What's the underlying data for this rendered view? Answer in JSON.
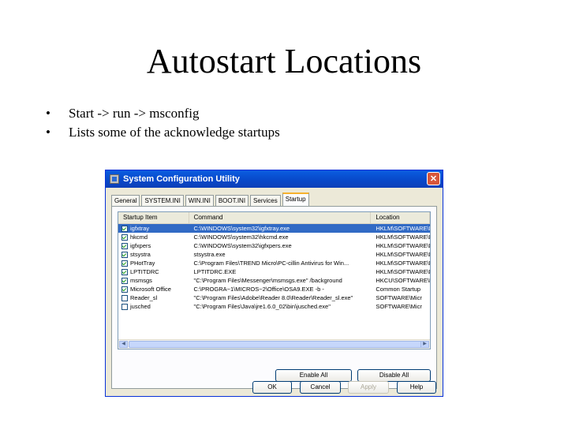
{
  "slide": {
    "title": "Autostart Locations",
    "bullets": [
      "Start -> run -> msconfig",
      "Lists some of the acknowledge startups"
    ]
  },
  "window": {
    "title": "System Configuration Utility",
    "close_label": "✕",
    "tabs": [
      "General",
      "SYSTEM.INI",
      "WIN.INI",
      "BOOT.INI",
      "Services",
      "Startup"
    ],
    "active_tab": "Startup",
    "list": {
      "columns": [
        "Startup Item",
        "Command",
        "Location"
      ],
      "rows": [
        {
          "item": "igfxtray",
          "command": "C:\\WINDOWS\\system32\\igfxtray.exe",
          "location": "HKLM\\SOFTWARE\\M",
          "checked": true,
          "selected": true
        },
        {
          "item": "hkcmd",
          "command": "C:\\WINDOWS\\system32\\hkcmd.exe",
          "location": "HKLM\\SOFTWARE\\M",
          "checked": true,
          "selected": false
        },
        {
          "item": "igfxpers",
          "command": "C:\\WINDOWS\\system32\\igfxpers.exe",
          "location": "HKLM\\SOFTWARE\\M",
          "checked": true,
          "selected": false
        },
        {
          "item": "stsystra",
          "command": "stsystra.exe",
          "location": "HKLM\\SOFTWARE\\M",
          "checked": true,
          "selected": false
        },
        {
          "item": "PHotTray",
          "command": "C:\\Program Files\\TREND Micro\\PC-cillin Antivirus for Win...",
          "location": "HKLM\\SOFTWARE\\M",
          "checked": true,
          "selected": false
        },
        {
          "item": "LPTITDRC",
          "command": "LPTITDRC.EXE",
          "location": "HKLM\\SOFTWARE\\M",
          "checked": true,
          "selected": false
        },
        {
          "item": "msmsgs",
          "command": "\"C:\\Program Files\\Messenger\\msmsgs.exe\" /background",
          "location": "HKCU\\SOFTWARE\\M",
          "checked": true,
          "selected": false
        },
        {
          "item": "Microsoft Office",
          "command": "C:\\PROGRA~1\\MICROS~2\\Office\\OSA9.EXE -b -",
          "location": "Common Startup",
          "checked": true,
          "selected": false
        },
        {
          "item": "Reader_sl",
          "command": "\"C:\\Program Files\\Adobe\\Reader 8.0\\Reader\\Reader_sl.exe\"",
          "location": "SOFTWARE\\Micr",
          "checked": false,
          "selected": false
        },
        {
          "item": "jusched",
          "command": "\"C:\\Program Files\\Java\\jre1.6.0_02\\bin\\jusched.exe\"",
          "location": "SOFTWARE\\Micr",
          "checked": false,
          "selected": false
        }
      ]
    },
    "buttons": {
      "enable_all": "Enable All",
      "disable_all": "Disable All",
      "ok": "OK",
      "cancel": "Cancel",
      "apply": "Apply",
      "help": "Help"
    }
  }
}
